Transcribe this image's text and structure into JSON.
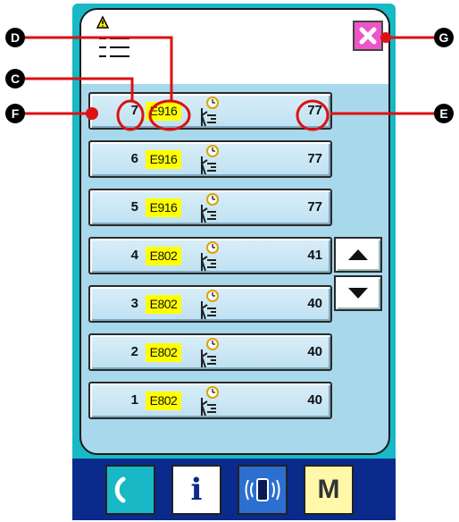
{
  "rows": [
    {
      "num": "7",
      "code": "E916",
      "count": "77"
    },
    {
      "num": "6",
      "code": "E916",
      "count": "77"
    },
    {
      "num": "5",
      "code": "E916",
      "count": "77"
    },
    {
      "num": "4",
      "code": "E802",
      "count": "41"
    },
    {
      "num": "3",
      "code": "E802",
      "count": "40"
    },
    {
      "num": "2",
      "code": "E802",
      "count": "40"
    },
    {
      "num": "1",
      "code": "E802",
      "count": "40"
    }
  ],
  "toolbar": {
    "info_label": "i",
    "mode_label": "M"
  },
  "callouts": {
    "c": "C",
    "d": "D",
    "e": "E",
    "f": "F",
    "g": "G"
  },
  "colors": {
    "frame": "#18b8c6",
    "panel": "#a8d8ec",
    "code_bg": "#ffff00",
    "close_bg": "#ee55c8",
    "toolbar_bg": "#0a2a8c",
    "callout_line": "#dd1111"
  },
  "icons": {
    "warning": "warning-icon",
    "list": "list-icon",
    "close": "close-icon",
    "row": "person-timer-icon",
    "up": "up-arrow-icon",
    "down": "down-arrow-icon",
    "reset": "reset-icon",
    "communication": "communication-icon"
  }
}
